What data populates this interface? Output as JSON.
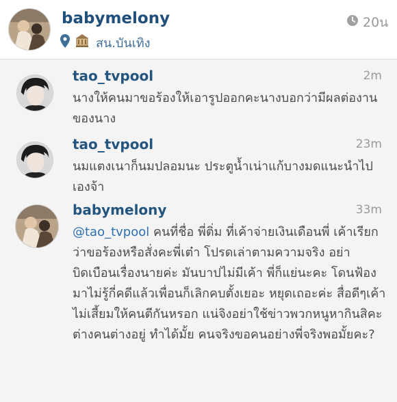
{
  "post": {
    "username": "babymelony",
    "location": "สน.บันเทิง",
    "time": "20น",
    "icons": {
      "location": "location-pin-icon",
      "place": "building-icon",
      "time": "clock-icon"
    }
  },
  "comments": [
    {
      "username": "tao_tvpool",
      "time": "2m",
      "text": "นางให้คนมาขอร้องให้เอารูปออกคะนางบอกว่ามีผลต่องานของนาง"
    },
    {
      "username": "tao_tvpool",
      "time": "23m",
      "text": "นมแตงเนาก็นมปลอมนะ ประตูน้ำเน่าแก้บางมดแนะนำไปเองจ้า"
    },
    {
      "username": "babymelony",
      "time": "33m",
      "mention": "@tao_tvpool",
      "text": " คนที่ชื่อ พี่ติ่ม ที่เค้าจ่ายเงินเดือนพี่ เค้าเรียกว่าขอร้องหรือสั่งคะพี่เต๋า โปรดเล่าตามความจริง อย่าบิดเบือนเรื่องนายค่ะ มันบาปไม่มีเค้า พี่ก็แย่นะคะ โดนฟ้องมาไม่รู้กี่คดีแล้วเพื่อนก็เลิกคบตั้งเยอะ หยุดเถอะค่ะ สื่อดีๆเค้าไม่เสี้ยมให้คนตีกันหรอก แน่จิงอย่าใช้ข่าวพวกหนูหากินสิคะ ต่างคนต่างอยู่ ทำได้มั้ย คนจริงขอคนอย่างพี่จริงพอมั้ยคะ?"
    }
  ]
}
